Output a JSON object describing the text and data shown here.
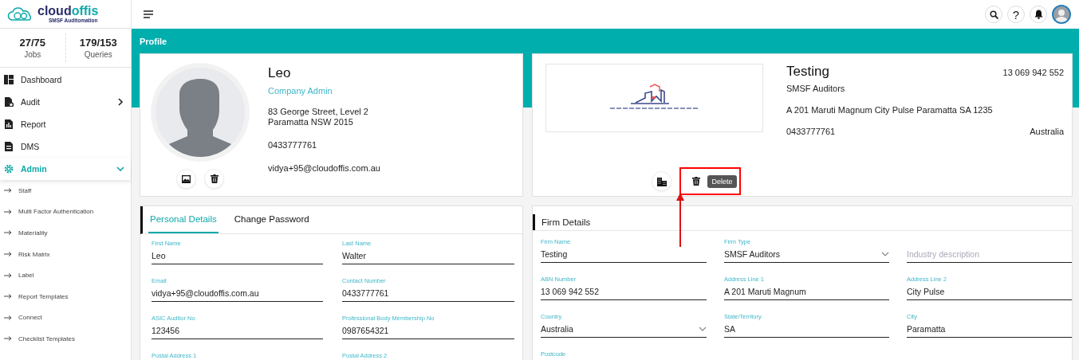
{
  "brand": {
    "name": "cloud**offis**",
    "tagline": "SMSF Auditomation"
  },
  "stats": [
    {
      "value": "27/75",
      "label": "Jobs"
    },
    {
      "value": "179/153",
      "label": "Queries"
    }
  ],
  "nav": [
    {
      "label": "Dashboard",
      "selected": false
    },
    {
      "label": "Audit",
      "selected": false,
      "expanded": false
    },
    {
      "label": "Report",
      "selected": false
    },
    {
      "label": "DMS",
      "selected": false
    },
    {
      "label": "Admin",
      "selected": true,
      "expanded": true,
      "children": [
        {
          "label": "Staff"
        },
        {
          "label": "Multi Factor Authentication"
        },
        {
          "label": "Materiality"
        },
        {
          "label": "Risk Matrix"
        },
        {
          "label": "Label"
        },
        {
          "label": "Report Templates"
        },
        {
          "label": "Connect"
        },
        {
          "label": "Checklist Templates"
        }
      ]
    }
  ],
  "top_bar": {
    "help_label": "?"
  },
  "page_title": "Profile",
  "profile": {
    "name": "Leo",
    "role": "Company Admin",
    "address_lines": [
      "83 George Street, Level 2",
      "Paramatta NSW 2015"
    ],
    "phone": "0433777761",
    "email": "vidya+95@cloudoffis.com.au"
  },
  "company": {
    "name": "Testing",
    "abn": "13 069 942 552",
    "type": "SMSF Auditors",
    "address": "A 201 Maruti Magnum City Pulse Paramatta SA 1235",
    "phone": "0433777761",
    "country": "Australia",
    "tooltip": "Delete",
    "highlighted": true
  },
  "personal": {
    "tabs": [
      {
        "label": "Personal Details",
        "selected": true
      },
      {
        "label": "Change Password",
        "selected": false
      }
    ],
    "fields": [
      {
        "label": "First Name",
        "value": "Leo"
      },
      {
        "label": "Last Name",
        "value": "Walter"
      },
      {
        "label": "Email",
        "value": "vidya+95@cloudoffis.com.au"
      },
      {
        "label": "Contact Number",
        "value": "0433777761"
      },
      {
        "label": "ASIC Auditor No",
        "value": "123456"
      },
      {
        "label": "Professional Body Membership No",
        "value": "0987654321"
      },
      {
        "label": "Postal Address 1"
      },
      {
        "label": "Postal Address 2"
      }
    ]
  },
  "firm": {
    "title": "Firm Details",
    "fields": [
      {
        "kind": "text",
        "label": "Firm Name",
        "value": "Testing"
      },
      {
        "kind": "select",
        "label": "Firm Type",
        "value": "SMSF Auditors"
      },
      {
        "kind": "text",
        "placeholder": "Industry description"
      },
      {
        "kind": "text",
        "label": "ABN Number",
        "value": "13 069 942 552"
      },
      {
        "kind": "text",
        "label": "Address Line 1",
        "value": "A 201 Maruti Magnum"
      },
      {
        "kind": "text",
        "label": "Address Line 2",
        "value": "City Pulse"
      },
      {
        "kind": "select",
        "label": "Country",
        "value": "Australia"
      },
      {
        "kind": "text",
        "label": "State/Territory",
        "value": "SA"
      },
      {
        "kind": "text",
        "label": "City",
        "value": "Paramatta"
      },
      {
        "label": "Postcode"
      }
    ]
  }
}
